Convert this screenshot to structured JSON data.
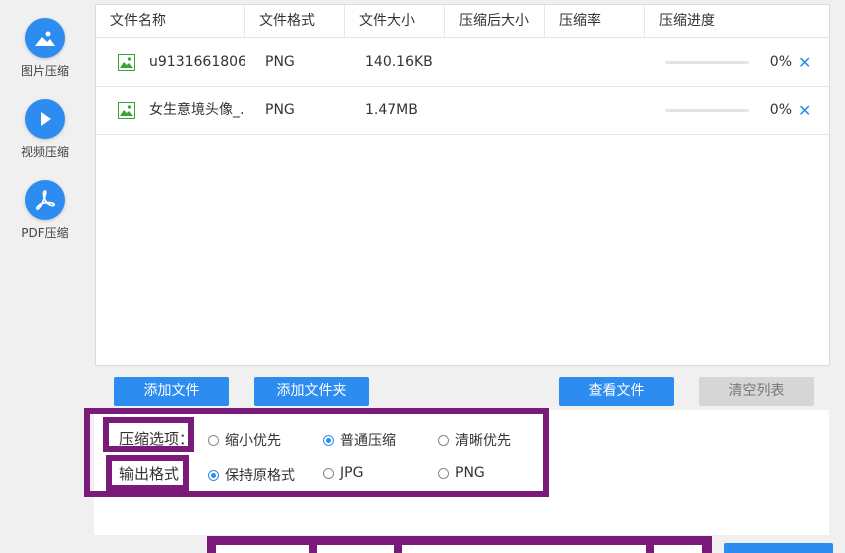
{
  "sidebar": {
    "items": [
      {
        "label": "图片压缩",
        "icon": "image-icon"
      },
      {
        "label": "视频压缩",
        "icon": "play-icon"
      },
      {
        "label": "PDF压缩",
        "icon": "pdf-icon"
      }
    ]
  },
  "table": {
    "headers": [
      "文件名称",
      "文件格式",
      "文件大小",
      "压缩后大小",
      "压缩率",
      "压缩进度"
    ],
    "rows": [
      {
        "name": "u9131661806...",
        "format": "PNG",
        "size": "140.16KB",
        "compressed_size": "",
        "ratio": "",
        "progress": 0,
        "progress_text": "0%",
        "remove": "✕"
      },
      {
        "name": "女生意境头像_...",
        "format": "PNG",
        "size": "1.47MB",
        "compressed_size": "",
        "ratio": "",
        "progress": 0,
        "progress_text": "0%",
        "remove": "✕"
      }
    ]
  },
  "buttons": {
    "add_file": "添加文件",
    "add_folder": "添加文件夹",
    "view_files": "查看文件",
    "clear_list": "清空列表"
  },
  "options": {
    "compress_label": "压缩选项：",
    "compress_choices": [
      "缩小优先",
      "普通压缩",
      "清晰优先"
    ],
    "compress_selected": "普通压缩",
    "format_label": "输出格式",
    "format_choices": [
      "保持原格式",
      "JPG",
      "PNG"
    ],
    "format_selected": "保持原格式"
  },
  "colors": {
    "accent": "#2d8cf0",
    "highlight_box": "#7a1b7a"
  }
}
